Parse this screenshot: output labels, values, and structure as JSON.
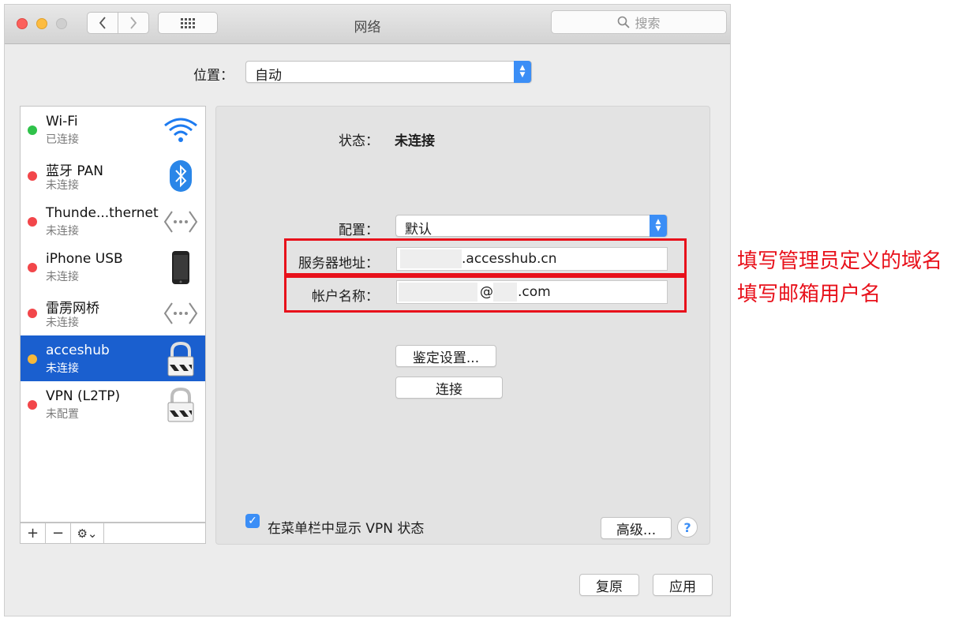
{
  "window": {
    "title": "网络"
  },
  "toolbar": {
    "search_placeholder": "搜索"
  },
  "location": {
    "label": "位置：",
    "value": "自动"
  },
  "services": [
    {
      "name": "Wi-Fi",
      "status": "已连接",
      "dot": "#2fc24a",
      "icon": "wifi-icon"
    },
    {
      "name": "蓝牙 PAN",
      "status": "未连接",
      "dot": "#f2464a",
      "icon": "bluetooth-icon"
    },
    {
      "name": "Thunde...thernet",
      "status": "未连接",
      "dot": "#f2464a",
      "icon": "ethernet-icon"
    },
    {
      "name": "iPhone USB",
      "status": "未连接",
      "dot": "#f2464a",
      "icon": "iphone-icon"
    },
    {
      "name": "雷雳网桥",
      "status": "未连接",
      "dot": "#f2464a",
      "icon": "ethernet-icon"
    },
    {
      "name": "acceshub",
      "status": "未连接",
      "dot": "#f6b83a",
      "icon": "vpn-lock-icon",
      "selected": true
    },
    {
      "name": "VPN (L2TP)",
      "status": "未配置",
      "dot": "#f2464a",
      "icon": "vpn-lock-icon"
    }
  ],
  "sidebar_toolbar": {
    "add": "+",
    "remove": "−",
    "gear": "⚙⌄"
  },
  "detail": {
    "status_label": "状态：",
    "status_value": "未连接",
    "config_label": "配置：",
    "config_value": "默认",
    "server_label": "服务器地址：",
    "server_value": ".accesshub.cn",
    "account_label": "帐户名称：",
    "account_at": "@",
    "account_domain": ".com",
    "auth_button": "鉴定设置...",
    "connect_button": "连接",
    "show_vpn_label": "在菜单栏中显示 VPN 状态",
    "show_vpn_checked": true,
    "advanced_button": "高级...",
    "help": "?"
  },
  "footer": {
    "revert": "复原",
    "apply": "应用"
  },
  "annotations": {
    "server_note": "填写管理员定义的域名",
    "account_note": "填写邮箱用户名",
    "color": "#e8111b"
  }
}
